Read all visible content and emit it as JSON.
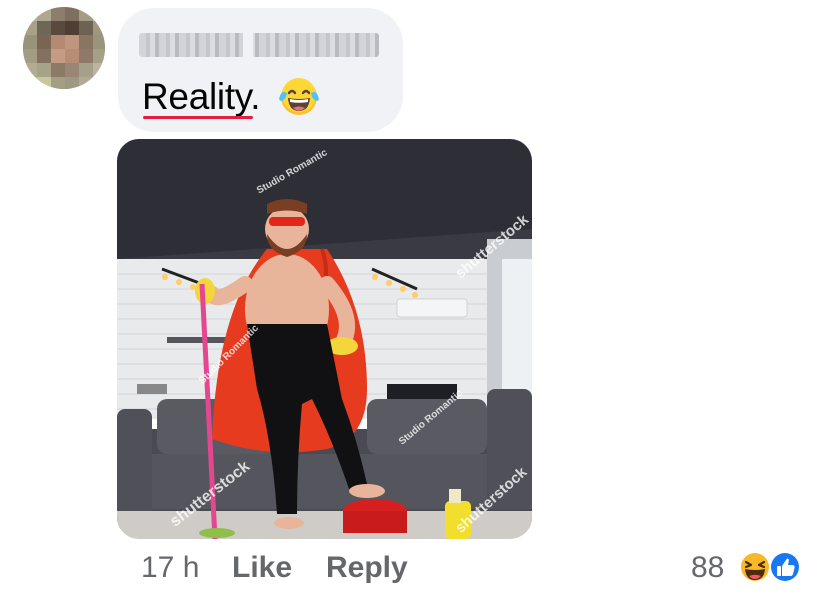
{
  "comment": {
    "author": {
      "name_obscured": true
    },
    "text": "Reality.",
    "emoji": "face-with-tears-of-joy"
  },
  "attachment": {
    "watermarks": [
      "Studio Romantic",
      "shutterstock",
      "Studio Romantic",
      "Studio Romantic",
      "shutterstock",
      "shutterstock"
    ]
  },
  "meta": {
    "time": "17 h",
    "like_label": "Like",
    "reply_label": "Reply",
    "reaction_count": "88",
    "reaction_icons": [
      "laughing-face-icon",
      "thumbs-up-icon"
    ]
  },
  "colors": {
    "bubble": "#f0f2f5",
    "text": "#050505",
    "secondary_text": "#65676b",
    "like_blue": "#1877f2",
    "spellcheck_red": "#e41e3f"
  }
}
